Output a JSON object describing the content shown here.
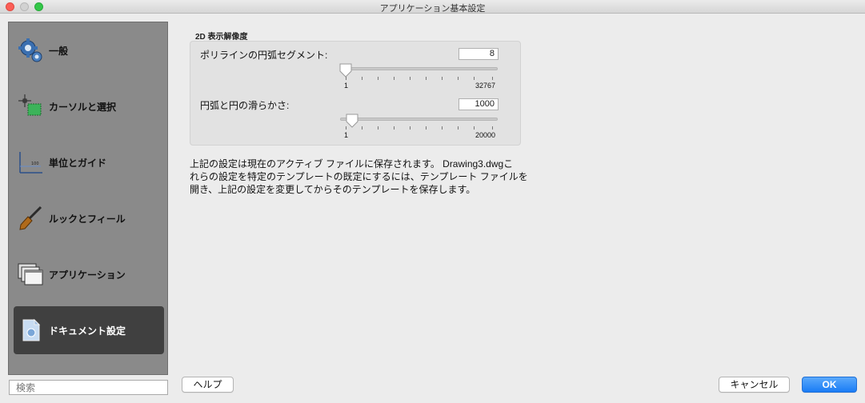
{
  "window": {
    "title": "アプリケーション基本設定"
  },
  "sidebar": {
    "items": [
      {
        "label": "一般",
        "icon": "gear-icon"
      },
      {
        "label": "カーソルと選択",
        "icon": "cursor-selection-icon"
      },
      {
        "label": "単位とガイド",
        "icon": "units-guides-icon"
      },
      {
        "label": "ルックとフィール",
        "icon": "brush-icon"
      },
      {
        "label": "アプリケーション",
        "icon": "windows-icon"
      },
      {
        "label": "ドキュメント設定",
        "icon": "document-icon"
      }
    ],
    "selected": "ドキュメント設定",
    "search_placeholder": "検索"
  },
  "main": {
    "group_title": "2D 表示解像度",
    "polyline": {
      "label": "ポリラインの円弧セグメント:",
      "value": "8",
      "min_label": "1",
      "max_label": "32767"
    },
    "smoothness": {
      "label": "円弧と円の滑らかさ:",
      "value": "1000",
      "min_label": "1",
      "max_label": "20000"
    },
    "info_lines": [
      "上記の設定は現在のアクティブ ファイルに保存されます。 Drawing3.dwgこ",
      "れらの設定を特定のテンプレートの既定にするには、テンプレート ファイルを",
      "開き、上記の設定を変更してからそのテンプレートを保存します。"
    ]
  },
  "footer": {
    "help_label": "ヘルプ",
    "cancel_label": "キャンセル",
    "ok_label": "OK"
  },
  "colors": {
    "accent": "#1a7cf5",
    "sidebar_bg": "#8a8a8a",
    "selected_bg": "#404040"
  }
}
